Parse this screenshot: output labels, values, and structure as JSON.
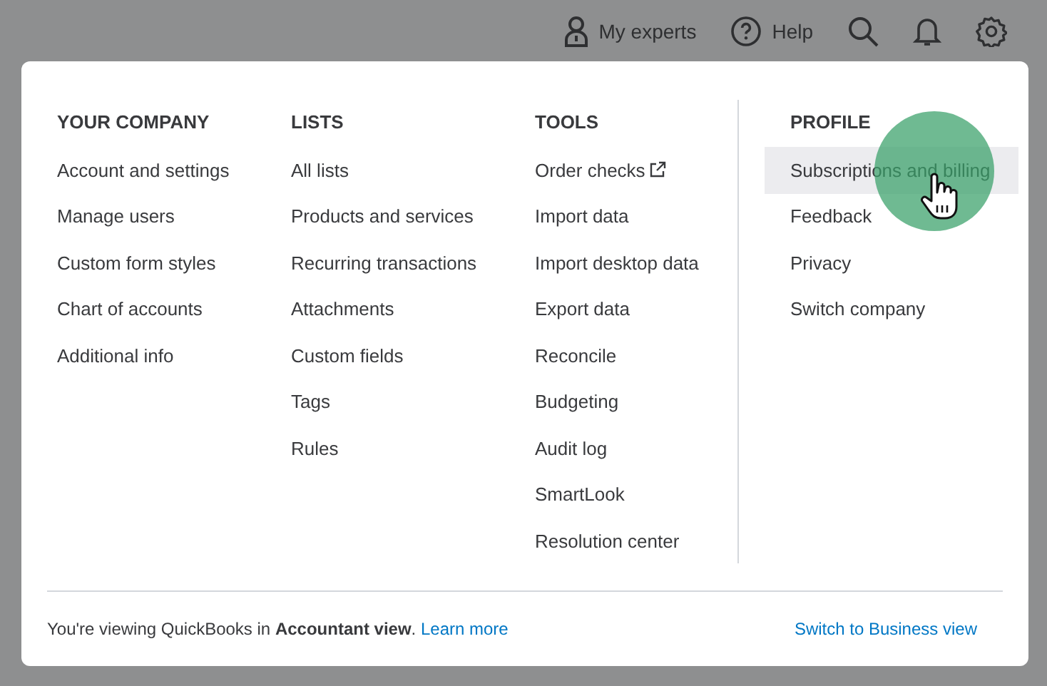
{
  "top_bar": {
    "experts": "My experts",
    "help": "Help"
  },
  "menu": {
    "columns": [
      {
        "heading": "YOUR COMPANY",
        "items": [
          {
            "label": "Account and settings",
            "selected": false
          },
          {
            "label": "Manage users",
            "selected": false
          },
          {
            "label": "Custom form styles",
            "selected": false
          },
          {
            "label": "Chart of accounts",
            "selected": false
          },
          {
            "label": "Additional info",
            "selected": false
          }
        ]
      },
      {
        "heading": "LISTS",
        "items": [
          {
            "label": "All lists",
            "selected": false
          },
          {
            "label": "Products and services",
            "selected": false
          },
          {
            "label": "Recurring transactions",
            "selected": false
          },
          {
            "label": "Attachments",
            "selected": false
          },
          {
            "label": "Custom fields",
            "selected": false
          },
          {
            "label": "Tags",
            "selected": false
          },
          {
            "label": "Rules",
            "selected": false
          }
        ]
      },
      {
        "heading": "TOOLS",
        "items": [
          {
            "label": "Order checks",
            "selected": false,
            "external": true
          },
          {
            "label": "Import data",
            "selected": false
          },
          {
            "label": "Import desktop data",
            "selected": false
          },
          {
            "label": "Export data",
            "selected": false
          },
          {
            "label": "Reconcile",
            "selected": false
          },
          {
            "label": "Budgeting",
            "selected": false
          },
          {
            "label": "Audit log",
            "selected": false
          },
          {
            "label": "SmartLook",
            "selected": false
          },
          {
            "label": "Resolution center",
            "selected": false
          }
        ]
      },
      {
        "heading": "PROFILE",
        "items": [
          {
            "label": "Subscriptions and billing",
            "selected": true
          },
          {
            "label": "Feedback",
            "selected": false
          },
          {
            "label": "Privacy",
            "selected": false
          },
          {
            "label": "Switch company",
            "selected": false
          }
        ]
      }
    ],
    "footer": {
      "note": "You're viewing QuickBooks in **Accountant view**.",
      "link": "Learn more",
      "switch": "Switch to Business view"
    }
  }
}
